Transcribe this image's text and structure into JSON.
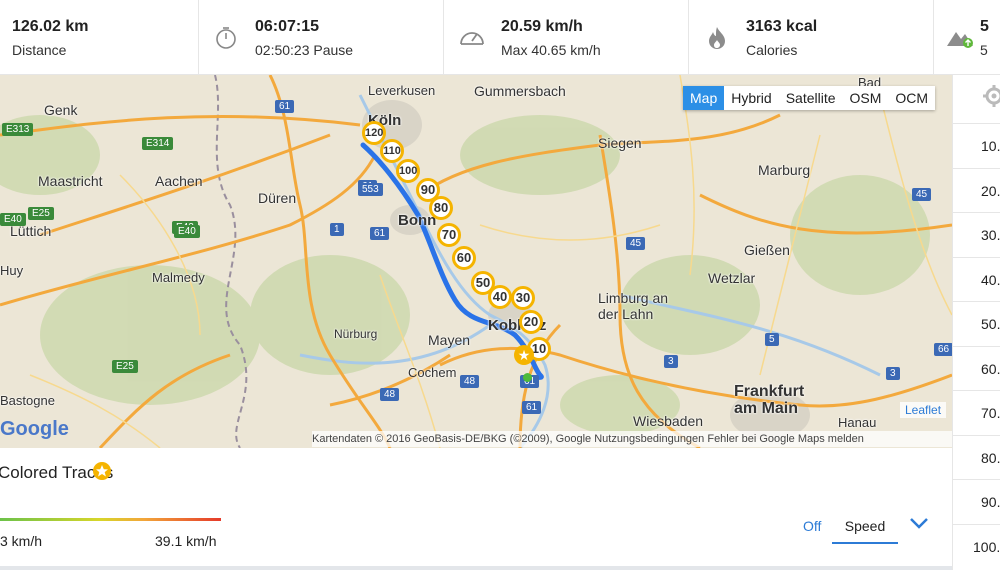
{
  "stats": [
    {
      "value": "126.02 km",
      "label": "Distance",
      "icon": "none"
    },
    {
      "value": "06:07:15",
      "label": "02:50:23 Pause",
      "icon": "stopwatch-icon"
    },
    {
      "value": "20.59 km/h",
      "label": "Max 40.65 km/h",
      "icon": "speedometer-icon"
    },
    {
      "value": "3163 kcal",
      "label": "Calories",
      "icon": "flame-icon"
    },
    {
      "value": "5",
      "label": "5",
      "icon": "mountain-icon"
    }
  ],
  "map": {
    "types": [
      "Map",
      "Hybrid",
      "Satellite",
      "OSM",
      "OCM"
    ],
    "active_type": "Map",
    "places": [
      {
        "name": "Leverkusen"
      },
      {
        "name": "Gummersbach"
      },
      {
        "name": "Köln"
      },
      {
        "name": "Genk"
      },
      {
        "name": "Siegen"
      },
      {
        "name": "Bad"
      },
      {
        "name": "Maastricht"
      },
      {
        "name": "Aachen"
      },
      {
        "name": "Düren"
      },
      {
        "name": "Bonn"
      },
      {
        "name": "Marburg"
      },
      {
        "name": "Lüttich"
      },
      {
        "name": "Gießen"
      },
      {
        "name": "Wetzlar"
      },
      {
        "name": "Limburg an der Lahn"
      },
      {
        "name": "Malmedy"
      },
      {
        "name": "Nürburg"
      },
      {
        "name": "Mayen"
      },
      {
        "name": "Koblenz"
      },
      {
        "name": "Cochem"
      },
      {
        "name": "Frankfurt am Main"
      },
      {
        "name": "Wiesbaden"
      },
      {
        "name": "Hanau"
      },
      {
        "name": "Huy"
      },
      {
        "name": "Bastogne"
      }
    ],
    "road_shields": [
      "E313",
      "E314",
      "E25",
      "E40",
      "E42",
      "E25",
      "61",
      "61",
      "553",
      "1",
      "61",
      "48",
      "61",
      "45",
      "3",
      "5",
      "45",
      "66",
      "3",
      "48",
      "61",
      "E40"
    ],
    "km_markers": [
      "120",
      "110",
      "100",
      "90",
      "80",
      "70",
      "60",
      "50",
      "40",
      "30",
      "20",
      "10"
    ],
    "attribution": "Kartendaten © 2016 GeoBasis-DE/BKG (©2009), Google   Nutzungsbedingungen   Fehler bei Google Maps melden",
    "leaflet": "Leaflet",
    "google": "Google",
    "colors": {
      "route": "#2a73e8",
      "marker": "#f5b400"
    }
  },
  "right_panel": {
    "rows": [
      "10.",
      "20.",
      "30.",
      "40.",
      "50.",
      "60.",
      "70.",
      "80.",
      "90.",
      "100."
    ]
  },
  "traces": {
    "title": "Colored Traces"
  },
  "legend": {
    "min": "3 km/h",
    "max": "39.1 km/h",
    "off": "Off",
    "speed": "Speed"
  }
}
